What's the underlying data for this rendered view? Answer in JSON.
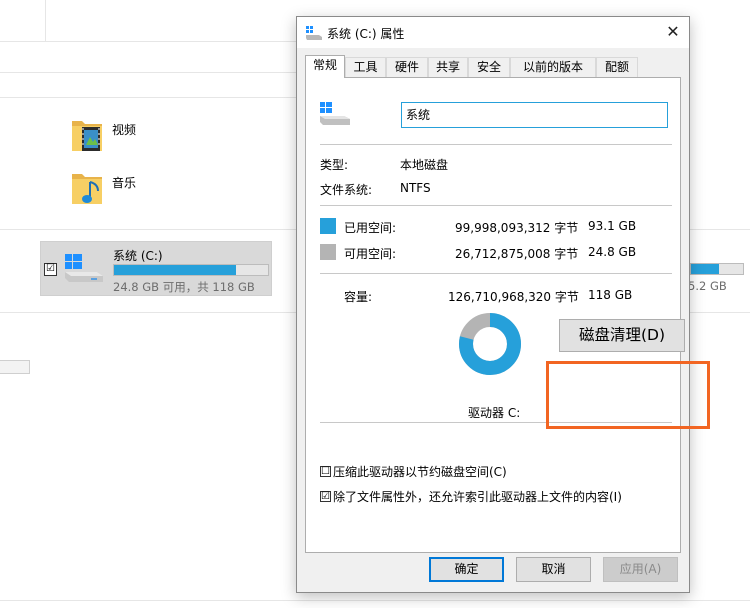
{
  "explorer": {
    "folders": [
      {
        "label": "视频",
        "icon": "video-folder-icon"
      },
      {
        "label": "音乐",
        "icon": "music-folder-icon"
      }
    ],
    "drive": {
      "name": "系统 (C:)",
      "checkbox_mark": "☑",
      "used_fraction": 0.79,
      "free_text": "24.8 GB 可用，共 118 GB",
      "icon": "windows-drive-icon"
    },
    "right_drive": {
      "used_fraction": 0.54,
      "partial_text": "5.2 GB"
    }
  },
  "dialog": {
    "title": "系统 (C:) 属性",
    "close_glyph": "✕",
    "tabs": [
      {
        "label": "常规",
        "active": true
      },
      {
        "label": "工具",
        "active": false
      },
      {
        "label": "硬件",
        "active": false
      },
      {
        "label": "共享",
        "active": false
      },
      {
        "label": "安全",
        "active": false
      },
      {
        "label": "以前的版本",
        "active": false
      },
      {
        "label": "配额",
        "active": false
      }
    ],
    "general": {
      "drive_name_value": "系统",
      "type_label": "类型:",
      "type_value": "本地磁盘",
      "fs_label": "文件系统:",
      "fs_value": "NTFS",
      "used_label": "已用空间:",
      "used_bytes": "99,998,093,312 字节",
      "used_size": "93.1 GB",
      "free_label": "可用空间:",
      "free_bytes": "26,712,875,008 字节",
      "free_size": "24.8 GB",
      "capacity_label": "容量:",
      "capacity_bytes": "126,710,968,320 字节",
      "capacity_size": "118 GB",
      "drive_letter_label": "驱动器 C:",
      "used_fraction": 0.789,
      "used_color": "#26a0da",
      "free_color": "#b4b4b4",
      "cleanup_button": "磁盘清理(D)",
      "compress_label": "压缩此驱动器以节约磁盘空间(C)",
      "compress_checked": "☐",
      "index_label": "除了文件属性外，还允许索引此驱动器上文件的内容(I)",
      "index_checked": "☑"
    },
    "buttons": {
      "ok": "确定",
      "cancel": "取消",
      "apply": "应用(A)"
    }
  },
  "highlight_color": "#f26522"
}
